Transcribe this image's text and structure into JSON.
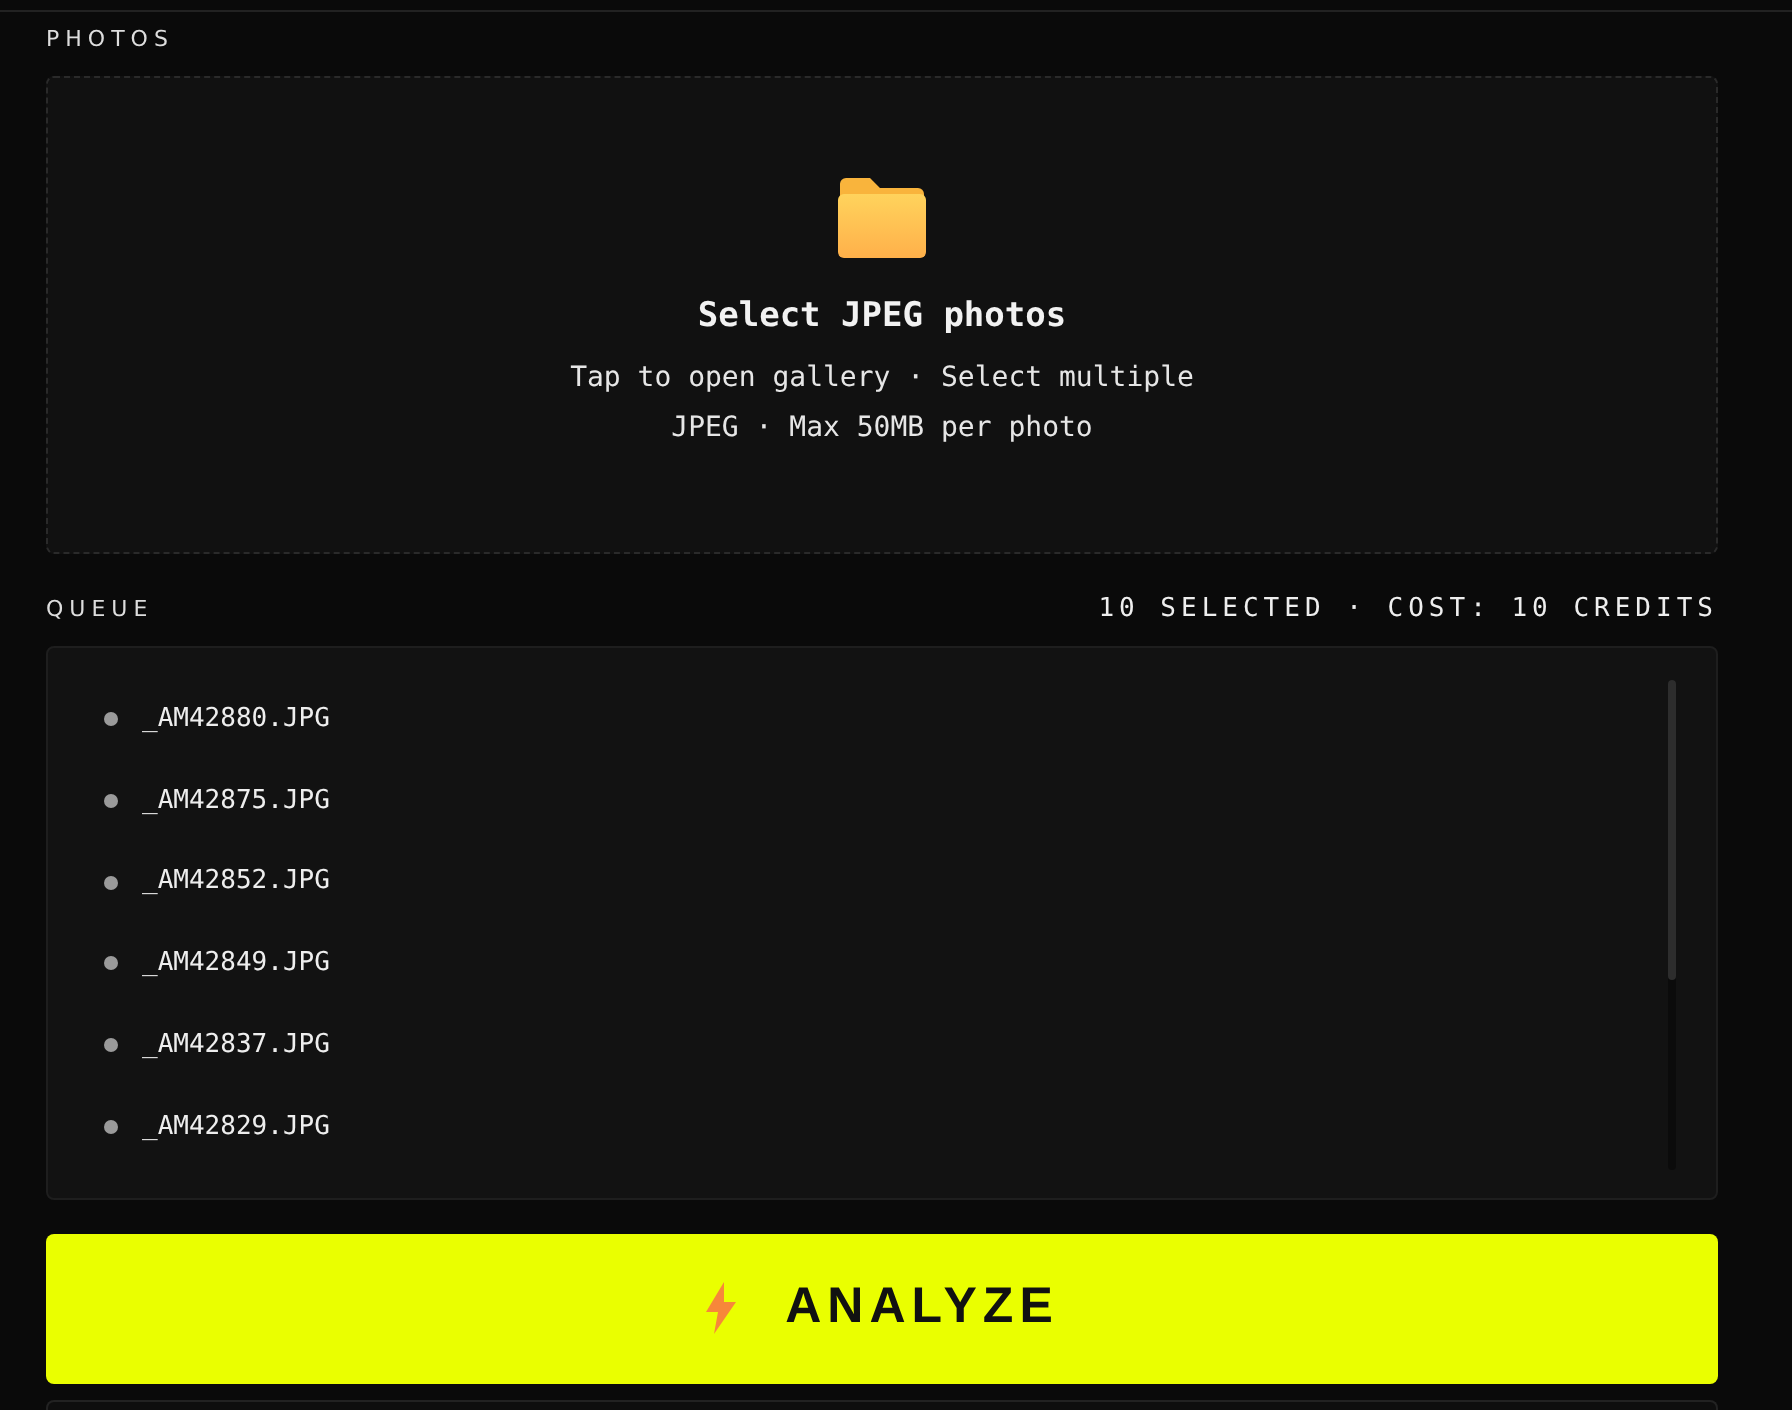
{
  "photos": {
    "label": "PHOTOS",
    "title": "Select JPEG photos",
    "hint": "Tap to open gallery · Select multiple",
    "limits": "JPEG · Max 50MB per photo"
  },
  "queue": {
    "label": "QUEUE",
    "summary": "10 SELECTED · COST: 10 CREDITS",
    "files": [
      {
        "name": "_AM42880.JPG"
      },
      {
        "name": "_AM42875.JPG"
      },
      {
        "name": "_AM42852.JPG"
      },
      {
        "name": "_AM42849.JPG"
      },
      {
        "name": "_AM42837.JPG"
      },
      {
        "name": "_AM42829.JPG"
      }
    ]
  },
  "analyze_button": {
    "label": "ANALYZE"
  }
}
